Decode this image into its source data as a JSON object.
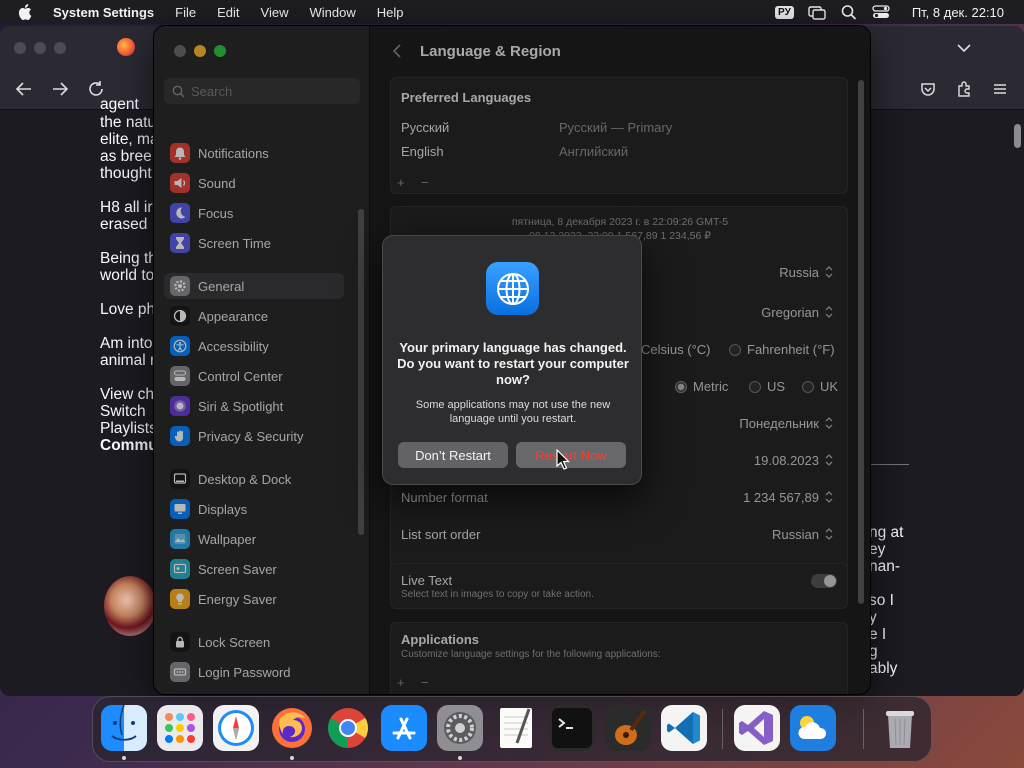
{
  "menubar": {
    "app_name": "System Settings",
    "menus": [
      "File",
      "Edit",
      "View",
      "Window",
      "Help"
    ],
    "keyboard_layout": "РУ",
    "clock": "Пт, 8 дек.  22:10"
  },
  "firefox": {
    "page_lines": [
      {
        "text": "agent",
        "bold": false
      },
      {
        "text": "the natu",
        "bold": false
      },
      {
        "text": "elite, ma",
        "bold": false
      },
      {
        "text": "as bree",
        "bold": false
      },
      {
        "text": "thought",
        "bold": false
      },
      {
        "text": "H8 all ir",
        "bold": false
      },
      {
        "text": "erased",
        "bold": false
      },
      {
        "text": "Being th",
        "bold": false
      },
      {
        "text": "world to",
        "bold": false
      },
      {
        "text": "Love ph",
        "bold": false
      },
      {
        "text": "Am into",
        "bold": false
      },
      {
        "text": "animal r",
        "bold": false
      },
      {
        "text": "View ch",
        "bold": false
      },
      {
        "text": "Switch",
        "bold": false
      },
      {
        "text": "Playlists",
        "bold": false
      },
      {
        "text": "Commu",
        "bold": true
      }
    ],
    "right_lines": [
      "ng at",
      "ey",
      "nan-",
      "so I",
      "y",
      "e I",
      "g",
      "ably"
    ]
  },
  "settings": {
    "search_placeholder": "Search",
    "sidebar": [
      {
        "label": "Notifications",
        "icon": "bell-icon",
        "color": "#e2453c"
      },
      {
        "label": "Sound",
        "icon": "speaker-icon",
        "color": "#e2453c"
      },
      {
        "label": "Focus",
        "icon": "moon-icon",
        "color": "#5e5ce6"
      },
      {
        "label": "Screen Time",
        "icon": "hourglass-icon",
        "color": "#5e5ce6"
      },
      {
        "label": "General",
        "icon": "gear-icon",
        "color": "#8e8e93"
      },
      {
        "label": "Appearance",
        "icon": "appearance-icon",
        "color": "#1c1c1e"
      },
      {
        "label": "Accessibility",
        "icon": "accessibility-icon",
        "color": "#0a84ff"
      },
      {
        "label": "Control Center",
        "icon": "control-center-icon",
        "color": "#8e8e93"
      },
      {
        "label": "Siri & Spotlight",
        "icon": "siri-icon",
        "color": "#6a3fd6"
      },
      {
        "label": "Privacy & Security",
        "icon": "hand-icon",
        "color": "#0a84ff"
      },
      {
        "label": "Desktop & Dock",
        "icon": "dock-icon",
        "color": "#1c1c1e"
      },
      {
        "label": "Displays",
        "icon": "display-icon",
        "color": "#0a84ff"
      },
      {
        "label": "Wallpaper",
        "icon": "wallpaper-icon",
        "color": "#30a7e6"
      },
      {
        "label": "Screen Saver",
        "icon": "screensaver-icon",
        "color": "#30b0c7"
      },
      {
        "label": "Energy Saver",
        "icon": "bulb-icon",
        "color": "#ffb020"
      },
      {
        "label": "Lock Screen",
        "icon": "lock-icon",
        "color": "#1c1c1e"
      },
      {
        "label": "Login Password",
        "icon": "login-password-icon",
        "color": "#8e8e93"
      }
    ],
    "selected_item": "General",
    "content": {
      "title": "Language & Region",
      "preferred_languages": {
        "title": "Preferred Languages",
        "rows": [
          {
            "name": "Русский",
            "detail": "Русский — Primary"
          },
          {
            "name": "English",
            "detail": "Английский"
          }
        ]
      },
      "preview": {
        "line1": "пятница, 8 декабря 2023 г. в 22:09:26 GMT-5",
        "line2": "08.12.2023, 22:09        1 567,89        1 234,56 ₽"
      },
      "region_value": "Russia",
      "calendar_value": "Gregorian",
      "temperature": {
        "celsius": "Celsius (°C)",
        "fahrenheit": "Fahrenheit (°F)"
      },
      "measurement": {
        "metric": "Metric",
        "us": "US",
        "uk": "UK"
      },
      "first_day_value": "Понедельник",
      "date_format_value": "19.08.2023",
      "number_format": {
        "label": "Number format",
        "value": "1 234 567,89"
      },
      "list_sort": {
        "label": "List sort order",
        "value": "Russian"
      },
      "live_text": {
        "label": "Live Text",
        "sub": "Select text in images to copy or take action."
      },
      "applications": {
        "title": "Applications",
        "sub": "Customize language settings for the following applications:"
      }
    },
    "dialog": {
      "title": "Your primary language has changed. Do you want to restart your computer now?",
      "message": "Some applications may not use the new language until you restart.",
      "secondary_button": "Don’t Restart",
      "primary_button": "Restart Now"
    }
  },
  "dock": [
    {
      "name": "Finder",
      "icon": "finder-icon",
      "running": true
    },
    {
      "name": "Launchpad",
      "icon": "launchpad-icon",
      "running": false
    },
    {
      "name": "Safari",
      "icon": "safari-icon",
      "running": false
    },
    {
      "name": "Firefox",
      "icon": "firefox-icon",
      "running": true
    },
    {
      "name": "Chrome",
      "icon": "chrome-icon",
      "running": false
    },
    {
      "name": "App Store",
      "icon": "app-store-icon",
      "running": false
    },
    {
      "name": "System Settings",
      "icon": "system-settings-icon",
      "running": true
    },
    {
      "name": "TextEdit",
      "icon": "textedit-icon",
      "running": false
    },
    {
      "name": "Terminal",
      "icon": "terminal-icon",
      "running": false
    },
    {
      "name": "GarageBand",
      "icon": "garageband-icon",
      "running": false
    },
    {
      "name": "VS Code",
      "icon": "vscode-icon",
      "running": false
    },
    {
      "name": "Visual Studio",
      "icon": "visual-studio-icon",
      "running": false
    },
    {
      "name": "Weather",
      "icon": "weather-icon",
      "running": false
    },
    {
      "name": "Trash",
      "icon": "trash-icon",
      "running": false
    }
  ]
}
